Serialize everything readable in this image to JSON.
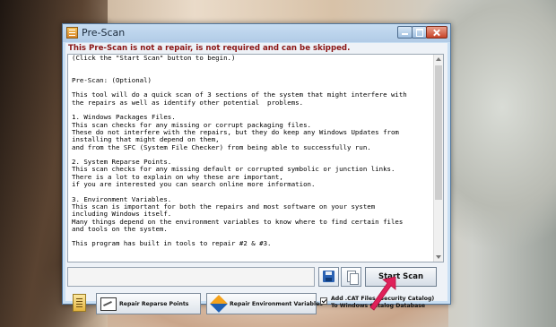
{
  "window": {
    "title": "Pre-Scan",
    "warning": "This Pre-Scan is not a repair, is not required and can be skipped."
  },
  "body_text": "(Click the \"Start Scan\" button to begin.)\n\n\nPre-Scan: (Optional)\n\nThis tool will do a quick scan of 3 sections of the system that might interfere with\nthe repairs as well as identify other potential  problems.\n\n1. Windows Packages Files.\nThis scan checks for any missing or corrupt packaging files.\nThese do not interfere with the repairs, but they do keep any Windows Updates from\ninstalling that might depend on them,\nand from the SFC (System File Checker) from being able to successfully run.\n\n2. System Reparse Points.\nThis scan checks for any missing default or corrupted symbolic or junction links.\nThere is a lot to explain on why these are important,\nif you are interested you can search online more information.\n\n3. Environment Variables.\nThis scan is important for both the repairs and most software on your system\nincluding Windows itself.\nMany things depend on the environment variables to know where to find certain files\nand tools on the system.\n\nThis program has built in tools to repair #2 & #3.",
  "buttons": {
    "start_scan": "Start Scan",
    "repair_reparse": "Repair Reparse Points",
    "repair_env": "Repair Environment Variables"
  },
  "checkbox": {
    "label": "Add .CAT Files (Security Catalog) To Windows Catalog Database",
    "checked": true
  },
  "icons": {
    "app": "app-icon",
    "save": "save-icon",
    "copy": "copy-icon",
    "tool": "clipboard-icon",
    "pointer": "arrow-pointer-icon"
  },
  "colors": {
    "warning": "#8a1515",
    "pointer": "#e0205a"
  }
}
